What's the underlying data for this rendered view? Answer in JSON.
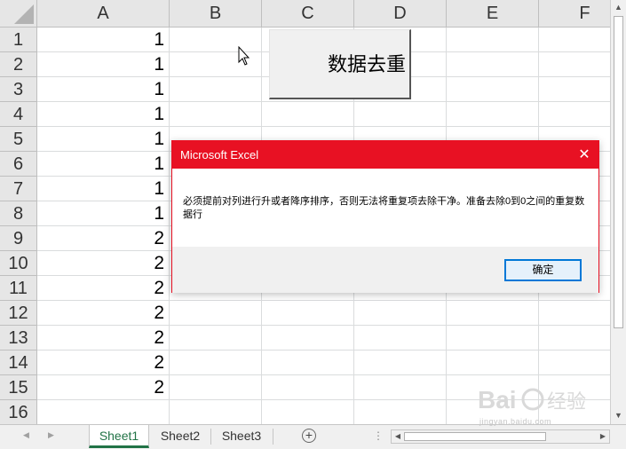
{
  "sheet": {
    "columns": [
      "A",
      "B",
      "C",
      "D",
      "E",
      "F"
    ],
    "rows": [
      "1",
      "2",
      "3",
      "4",
      "5",
      "6",
      "7",
      "8",
      "9",
      "10",
      "11",
      "12",
      "13",
      "14",
      "15",
      "16"
    ],
    "col_a_values": [
      "1",
      "1",
      "1",
      "1",
      "1",
      "1",
      "1",
      "1",
      "2",
      "2",
      "2",
      "2",
      "2",
      "2",
      "2",
      ""
    ]
  },
  "button": {
    "label": "数据去重"
  },
  "dialog": {
    "title": "Microsoft Excel",
    "message": "必须提前对列进行升或者降序排序，否则无法将重复项去除干净。准备去除0到0之间的重复数据行",
    "ok_label": "确定",
    "close_glyph": "✕"
  },
  "tabs": [
    {
      "label": "Sheet1",
      "active": true
    },
    {
      "label": "Sheet2",
      "active": false
    },
    {
      "label": "Sheet3",
      "active": false
    }
  ],
  "add_sheet_glyph": "+",
  "watermark": {
    "text": "jingyan.baidu.com"
  },
  "colors": {
    "dialog_red": "#e81123",
    "tab_green": "#217346",
    "ok_border": "#0078d7"
  }
}
